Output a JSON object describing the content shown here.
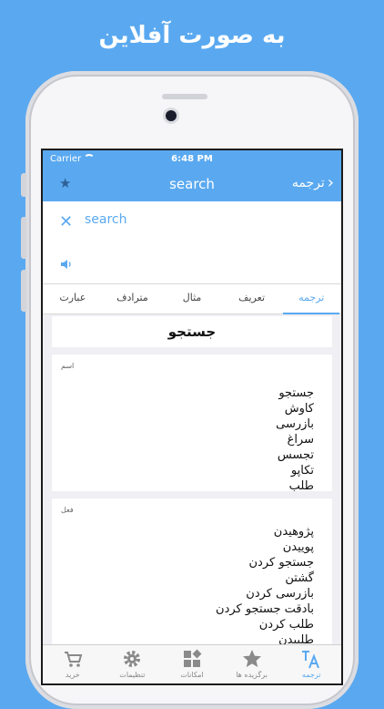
{
  "promo": {
    "headline": "به صورت آفلاین"
  },
  "status": {
    "carrier": "Carrier",
    "time": "6:48 PM"
  },
  "nav": {
    "title": "search",
    "back_label": "ترجمه"
  },
  "search": {
    "value": "search"
  },
  "tabs": [
    "ترجمه",
    "تعریف",
    "مثال",
    "مترادف",
    "عبارت"
  ],
  "active_tab": "ترجمه",
  "translation": {
    "main_word": "جستجو",
    "sections": [
      {
        "pos": "اسم",
        "words": [
          "جستجو",
          "کاوش",
          "بازرسی",
          "سراغ",
          "تجسس",
          "تکاپو",
          "طلب"
        ]
      },
      {
        "pos": "فعل",
        "words": [
          "پژوهیدن",
          "پوییدن",
          "جستجو کردن",
          "گشتن",
          "بازرسی کردن",
          "بادقت جستجو کردن",
          "طلب کردن",
          "طلبیدن"
        ]
      }
    ]
  },
  "tabbar": [
    {
      "label": "خرید",
      "icon": "cart-icon"
    },
    {
      "label": "تنظیمات",
      "icon": "gear-icon"
    },
    {
      "label": "امکانات",
      "icon": "grid-icon"
    },
    {
      "label": "برگزیده ها",
      "icon": "star-icon"
    },
    {
      "label": "ترجمه",
      "icon": "translate-icon",
      "active": true
    }
  ],
  "colors": {
    "accent": "#5aa9f0",
    "background": "#5aa9f0"
  }
}
